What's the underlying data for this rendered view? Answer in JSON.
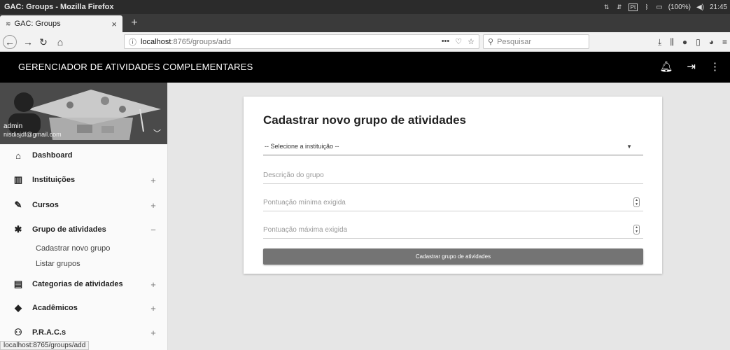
{
  "os_bar": {
    "window_title": "GAC: Groups - Mozilla Firefox",
    "language": "Pt",
    "battery": "(100%)",
    "clock": "21:45"
  },
  "browser": {
    "tab_title": "GAC: Groups",
    "tab_close": "×",
    "new_tab": "+",
    "url_host": "localhost",
    "url_path": ":8765/groups/add",
    "search_placeholder": "Pesquisar",
    "page_actions": "•••",
    "status_url": "localhost:8765/groups/add"
  },
  "header": {
    "title": "GERENCIADOR DE ATIVIDADES COMPLEMENTARES",
    "icons": [
      "bell-icon",
      "logout-icon",
      "more-vert-icon"
    ]
  },
  "profile": {
    "name": "admin",
    "email": "nisdisjdf@gmail.com"
  },
  "sidebar": {
    "items": [
      {
        "label": "Dashboard",
        "icon": "home-icon",
        "toggle": ""
      },
      {
        "label": "Instituições",
        "icon": "building-icon",
        "toggle": "+"
      },
      {
        "label": "Cursos",
        "icon": "pencil-icon",
        "toggle": "+"
      },
      {
        "label": "Grupo de atividades",
        "icon": "puzzle-icon",
        "toggle": "−"
      },
      {
        "label": "Categorias de atividades",
        "icon": "clipboard-icon",
        "toggle": "+"
      },
      {
        "label": "Acadêmicos",
        "icon": "graduation-cap-icon",
        "toggle": "+"
      },
      {
        "label": "P.R.A.C.s",
        "icon": "people-icon",
        "toggle": "+"
      }
    ],
    "subitems": [
      "Cadastrar novo grupo",
      "Listar grupos"
    ]
  },
  "form": {
    "title": "Cadastrar novo grupo de atividades",
    "institution_select": "-- Selecione a instituição --",
    "description_placeholder": "Descrição do grupo",
    "min_score_placeholder": "Pontuação mínima exigida",
    "max_score_placeholder": "Pontuação máxima exigida",
    "submit_label": "Cadastrar grupo de atividades"
  }
}
